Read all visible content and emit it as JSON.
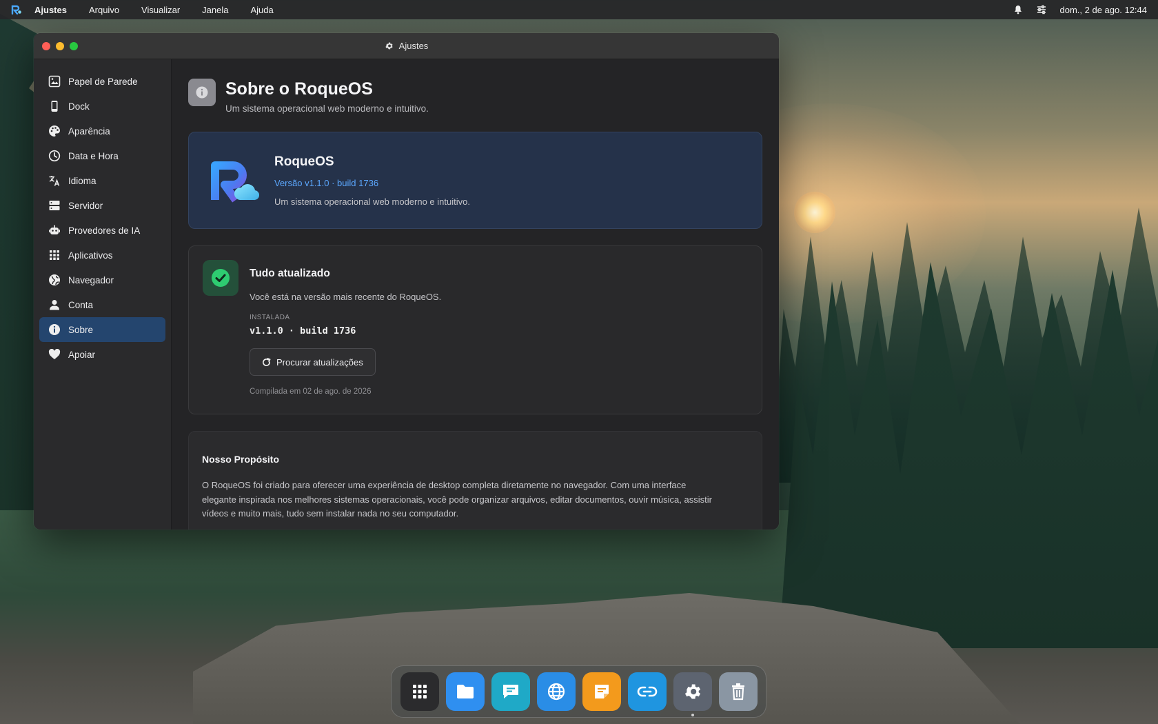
{
  "menubar": {
    "app_name": "Ajustes",
    "items": [
      "Arquivo",
      "Visualizar",
      "Janela",
      "Ajuda"
    ],
    "clock": "dom., 2 de ago. 12:44"
  },
  "window": {
    "title": "Ajustes"
  },
  "sidebar": {
    "items": [
      {
        "label": "Papel de Parede",
        "icon": "wallpaper-icon"
      },
      {
        "label": "Dock",
        "icon": "phone-icon"
      },
      {
        "label": "Aparência",
        "icon": "palette-icon"
      },
      {
        "label": "Data e Hora",
        "icon": "clock-icon"
      },
      {
        "label": "Idioma",
        "icon": "translate-icon"
      },
      {
        "label": "Servidor",
        "icon": "server-icon"
      },
      {
        "label": "Provedores de IA",
        "icon": "robot-icon"
      },
      {
        "label": "Aplicativos",
        "icon": "grid-icon"
      },
      {
        "label": "Navegador",
        "icon": "globe-icon"
      },
      {
        "label": "Conta",
        "icon": "user-icon"
      },
      {
        "label": "Sobre",
        "icon": "info-icon",
        "active": true
      },
      {
        "label": "Apoiar",
        "icon": "heart-icon"
      }
    ]
  },
  "page": {
    "title": "Sobre o RoqueOS",
    "subtitle": "Um sistema operacional web moderno e intuitivo."
  },
  "brand_card": {
    "name": "RoqueOS",
    "version": "Versão v1.1.0 · build 1736",
    "description": "Um sistema operacional web moderno e intuitivo."
  },
  "update_card": {
    "title": "Tudo atualizado",
    "text": "Você está na versão mais recente do RoqueOS.",
    "installed_label": "INSTALADA",
    "installed_version": "v1.1.0 · build 1736",
    "button_label": "Procurar atualizações",
    "built": "Compilada em 02 de ago. de 2026"
  },
  "purpose_card": {
    "title": "Nosso Propósito",
    "text": "O RoqueOS foi criado para oferecer uma experiência de desktop completa diretamente no navegador. Com uma interface elegante inspirada nos melhores sistemas operacionais, você pode organizar arquivos, editar documentos, ouvir música, assistir vídeos e muito mais, tudo sem instalar nada no seu computador."
  },
  "dock": {
    "apps": [
      {
        "icon": "apps-grid-icon",
        "color": "#2b2b2d"
      },
      {
        "icon": "folder-icon",
        "color": "#2f8ff0"
      },
      {
        "icon": "chat-icon",
        "color": "#1fa9c7"
      },
      {
        "icon": "globe-icon",
        "color": "#2a8de6"
      },
      {
        "icon": "notes-icon",
        "color": "#f39a1c"
      },
      {
        "icon": "link-icon",
        "color": "#1f95e0"
      },
      {
        "icon": "settings-icon",
        "color": "#5d6470",
        "running": true
      },
      {
        "icon": "trash-icon",
        "color": "#8a96a3"
      }
    ]
  },
  "colors": {
    "accent": "#24456e",
    "link": "#5ca8ff",
    "success": "#2ecc71"
  }
}
